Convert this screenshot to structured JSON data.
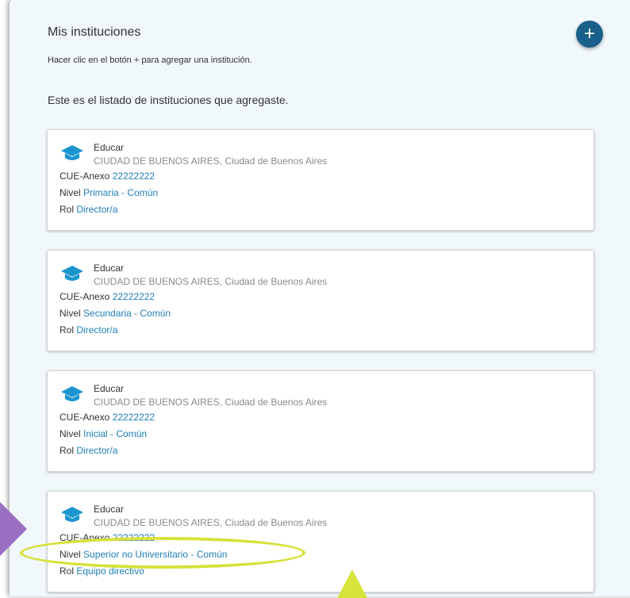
{
  "header": {
    "title": "Mis instituciones",
    "hint": "Hacer clic en el botón + para agregar una institución.",
    "listing_text": "Este es el listado de instituciones que agregaste.",
    "add_button": "+"
  },
  "labels": {
    "cue": "CUE-Anexo",
    "nivel": "Nivel",
    "rol": "Rol"
  },
  "institutions": [
    {
      "name": "Educar",
      "location": "CIUDAD DE BUENOS AIRES, Ciudad de Buenos Aires",
      "cue": "22222222",
      "nivel": "Primaria - Común",
      "rol": "Director/a"
    },
    {
      "name": "Educar",
      "location": "CIUDAD DE BUENOS AIRES, Ciudad de Buenos Aires",
      "cue": "22222222",
      "nivel": "Secundaria - Común",
      "rol": "Director/a"
    },
    {
      "name": "Educar",
      "location": "CIUDAD DE BUENOS AIRES, Ciudad de Buenos Aires",
      "cue": "22222222",
      "nivel": "Inicial - Común",
      "rol": "Director/a"
    },
    {
      "name": "Educar",
      "location": "CIUDAD DE BUENOS AIRES, Ciudad de Buenos Aires",
      "cue": "22222222",
      "nivel": "Superior no Universitario - Común",
      "rol": "Equipo directivo"
    }
  ],
  "icons": {
    "institution": "graduation-cap-icon",
    "add": "plus-icon"
  },
  "colors": {
    "accent": "#19608a",
    "link": "#1f7fb5",
    "icon": "#1c95cf",
    "panel_bg": "#f1f8fc",
    "highlight": "#d8e13a",
    "pointer_arrow": "#9a6fc1"
  }
}
